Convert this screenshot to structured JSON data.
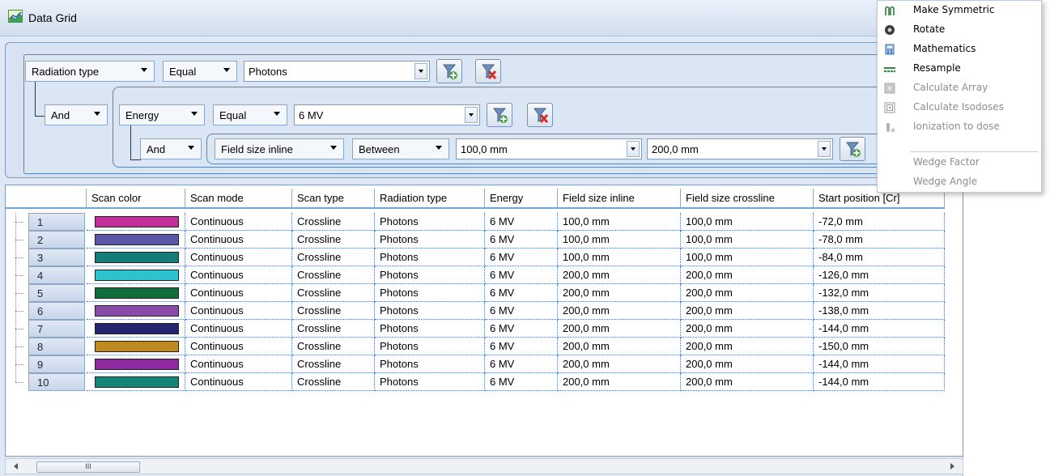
{
  "window": {
    "title": "Data Grid"
  },
  "filters": {
    "row1": {
      "field": "Radiation type",
      "op": "Equal",
      "value": "Photons"
    },
    "row2": {
      "logic": "And",
      "field": "Energy",
      "op": "Equal",
      "value": "6 MV"
    },
    "row3": {
      "logic": "And",
      "field": "Field size inline",
      "op": "Between",
      "value_from": "100,0 mm",
      "value_to": "200,0 mm"
    }
  },
  "grid": {
    "columns": [
      "Scan color",
      "Scan mode",
      "Scan type",
      "Radiation type",
      "Energy",
      "Field size inline",
      "Field size crossline",
      "Start position [Cr]"
    ],
    "rows": [
      {
        "n": "1",
        "color": "#c22e98",
        "mode": "Continuous",
        "type": "Crossline",
        "rad": "Photons",
        "energy": "6 MV",
        "fsi": "100,0 mm",
        "fsc": "100,0 mm",
        "start": "-72,0 mm"
      },
      {
        "n": "2",
        "color": "#5a57a8",
        "mode": "Continuous",
        "type": "Crossline",
        "rad": "Photons",
        "energy": "6 MV",
        "fsi": "100,0 mm",
        "fsc": "100,0 mm",
        "start": "-78,0 mm"
      },
      {
        "n": "3",
        "color": "#167c78",
        "mode": "Continuous",
        "type": "Crossline",
        "rad": "Photons",
        "energy": "6 MV",
        "fsi": "100,0 mm",
        "fsc": "100,0 mm",
        "start": "-84,0 mm"
      },
      {
        "n": "4",
        "color": "#2cc3cf",
        "mode": "Continuous",
        "type": "Crossline",
        "rad": "Photons",
        "energy": "6 MV",
        "fsi": "200,0 mm",
        "fsc": "200,0 mm",
        "start": "-126,0 mm"
      },
      {
        "n": "5",
        "color": "#0f6e3c",
        "mode": "Continuous",
        "type": "Crossline",
        "rad": "Photons",
        "energy": "6 MV",
        "fsi": "200,0 mm",
        "fsc": "200,0 mm",
        "start": "-132,0 mm"
      },
      {
        "n": "6",
        "color": "#8a4aa8",
        "mode": "Continuous",
        "type": "Crossline",
        "rad": "Photons",
        "energy": "6 MV",
        "fsi": "200,0 mm",
        "fsc": "200,0 mm",
        "start": "-138,0 mm"
      },
      {
        "n": "7",
        "color": "#262370",
        "mode": "Continuous",
        "type": "Crossline",
        "rad": "Photons",
        "energy": "6 MV",
        "fsi": "200,0 mm",
        "fsc": "200,0 mm",
        "start": "-144,0 mm"
      },
      {
        "n": "8",
        "color": "#c08a22",
        "mode": "Continuous",
        "type": "Crossline",
        "rad": "Photons",
        "energy": "6 MV",
        "fsi": "200,0 mm",
        "fsc": "200,0 mm",
        "start": "-150,0 mm"
      },
      {
        "n": "9",
        "color": "#8e2a9e",
        "mode": "Continuous",
        "type": "Crossline",
        "rad": "Photons",
        "energy": "6 MV",
        "fsi": "200,0 mm",
        "fsc": "200,0 mm",
        "start": "-144,0 mm"
      },
      {
        "n": "10",
        "color": "#178478",
        "mode": "Continuous",
        "type": "Crossline",
        "rad": "Photons",
        "energy": "6 MV",
        "fsi": "200,0 mm",
        "fsc": "200,0 mm",
        "start": "-144,0 mm"
      }
    ]
  },
  "scrollbar": {
    "thumb_label": "III"
  },
  "context_menu": {
    "items": [
      {
        "label": "Make Symmetric",
        "enabled": true,
        "icon": "make-symmetric-icon"
      },
      {
        "label": "Rotate",
        "enabled": true,
        "icon": "rotate-icon"
      },
      {
        "label": "Mathematics",
        "enabled": true,
        "icon": "calculator-icon"
      },
      {
        "label": "Resample",
        "enabled": true,
        "icon": "resample-icon"
      },
      {
        "label": "Calculate Array",
        "enabled": false,
        "icon": "calculate-array-icon"
      },
      {
        "label": "Calculate Isodoses",
        "enabled": false,
        "icon": "isodoses-icon"
      },
      {
        "label": "Ionization to dose",
        "enabled": false,
        "icon": "ionization-icon"
      },
      {
        "label": "Wedge Factor",
        "enabled": false,
        "icon": ""
      },
      {
        "label": "Wedge Angle",
        "enabled": false,
        "icon": ""
      }
    ]
  }
}
